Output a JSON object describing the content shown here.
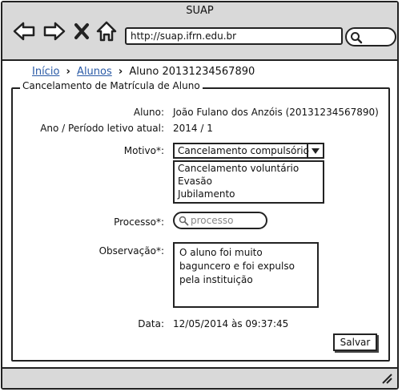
{
  "window": {
    "title": "SUAP"
  },
  "toolbar": {
    "icons": [
      "back-arrow-icon",
      "forward-arrow-icon",
      "close-x-icon",
      "home-icon"
    ],
    "url": "http://suap.ifrn.edu.br",
    "search_icon": "search-icon"
  },
  "breadcrumb": {
    "home": "Início",
    "students": "Alunos",
    "current": "Aluno 20131234567890",
    "separator": "›"
  },
  "form": {
    "legend": "Cancelamento de Matrícula de Aluno",
    "student_label": "Aluno:",
    "student_value": "João Fulano dos Anzóis (20131234567890)",
    "period_label": "Ano / Período letivo atual:",
    "period_value": "2014 / 1",
    "reason_label": "Motivo*:",
    "reason_selected": "Cancelamento compulsório",
    "reason_options": [
      "Cancelamento voluntário",
      "Evasão",
      "Jubilamento"
    ],
    "process_label": "Processo*:",
    "process_placeholder": "processo",
    "notes_label": "Observação*:",
    "notes_value": "O aluno foi muito baguncero e foi expulso pela instituição",
    "date_label": "Data:",
    "date_value": "12/05/2014 às 09:37:45",
    "save_label": "Salvar"
  },
  "colors": {
    "chrome": "#d9d9d9",
    "border": "#222222",
    "link": "#2a5aa6"
  }
}
